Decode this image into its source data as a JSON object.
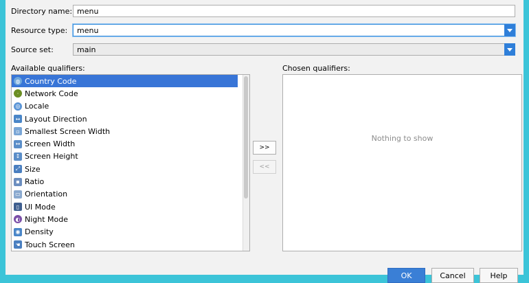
{
  "form": {
    "directory_name_label": "Directory name:",
    "directory_name_value": "menu",
    "resource_type_label": "Resource type:",
    "resource_type_value": "menu",
    "source_set_label": "Source set:",
    "source_set_value": "main"
  },
  "available": {
    "label": "Available qualifiers:",
    "items": [
      {
        "label": "Country Code",
        "icon": "globe-icon"
      },
      {
        "label": "Network Code",
        "icon": "network-icon"
      },
      {
        "label": "Locale",
        "icon": "locale-icon"
      },
      {
        "label": "Layout Direction",
        "icon": "layout-direction-icon"
      },
      {
        "label": "Smallest Screen Width",
        "icon": "smallest-width-icon"
      },
      {
        "label": "Screen Width",
        "icon": "screen-width-icon"
      },
      {
        "label": "Screen Height",
        "icon": "screen-height-icon"
      },
      {
        "label": "Size",
        "icon": "size-icon"
      },
      {
        "label": "Ratio",
        "icon": "ratio-icon"
      },
      {
        "label": "Orientation",
        "icon": "orientation-icon"
      },
      {
        "label": "UI Mode",
        "icon": "ui-mode-icon"
      },
      {
        "label": "Night Mode",
        "icon": "night-mode-icon"
      },
      {
        "label": "Density",
        "icon": "density-icon"
      },
      {
        "label": "Touch Screen",
        "icon": "touch-screen-icon"
      }
    ]
  },
  "chosen": {
    "label": "Chosen qualifiers:",
    "empty_text": "Nothing to show"
  },
  "move": {
    "add_label": ">>",
    "remove_label": "<<"
  },
  "buttons": {
    "ok": "OK",
    "cancel": "Cancel",
    "help": "Help"
  },
  "colors": {
    "accent": "#3875d7",
    "frame": "#3cc4d8"
  }
}
